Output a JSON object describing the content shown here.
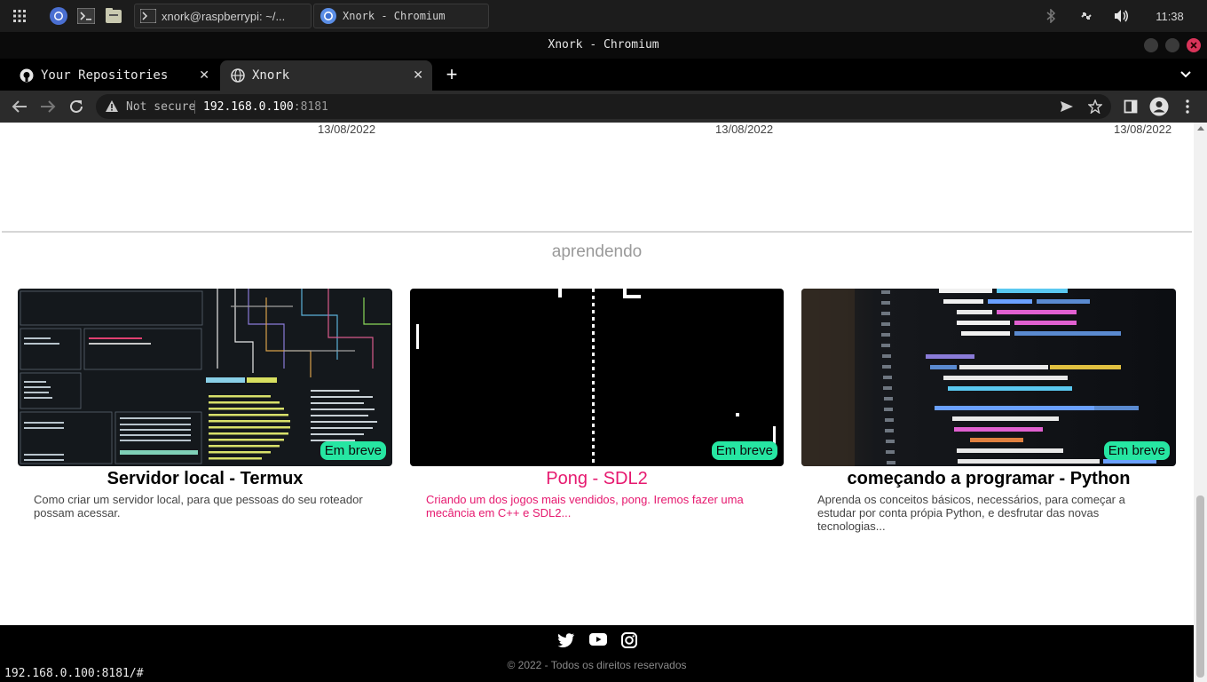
{
  "taskbar": {
    "tasks": [
      {
        "label": "xnork@raspberrypi: ~/..."
      },
      {
        "label": "Xnork - Chromium"
      }
    ],
    "clock": "11:38"
  },
  "window": {
    "title": "Xnork - Chromium"
  },
  "tabs": [
    {
      "label": "Your Repositories"
    },
    {
      "label": "Xnork"
    }
  ],
  "omnibox": {
    "security": "Not secure",
    "host": "192.168.0.100",
    "port": ":8181"
  },
  "page": {
    "dates": [
      "13/08/2022",
      "13/08/2022",
      "13/08/2022"
    ],
    "section_title": "aprendendo",
    "cards": [
      {
        "title": "Servidor local - Termux",
        "description": "Como criar um servidor local, para que pessoas do seu roteador possam acessar.",
        "badge": "Em breve"
      },
      {
        "title": "Pong - SDL2",
        "description": "Criando um dos jogos mais vendidos, pong. Iremos fazer uma mecância em C++ e SDL2...",
        "badge": "Em breve"
      },
      {
        "title": "começando a programar - Python",
        "description": "Aprenda os conceitos básicos, necessários, para começar a estudar por conta própia Python, e desfrutar das novas tecnologias...",
        "badge": "Em breve"
      }
    ],
    "footer": {
      "copyright": "© 2022 - Todos os direitos reservados"
    }
  },
  "status_url": "192.168.0.100:8181/#",
  "colors": {
    "badge": "#26e6a2",
    "highlight": "#e6196f",
    "footer": "#000000"
  },
  "icons": [
    "apps-icon",
    "chromium-icon",
    "terminal-icon",
    "files-icon",
    "bluetooth-icon",
    "network-icon",
    "volume-icon",
    "github-icon",
    "globe-icon",
    "twitter-icon",
    "youtube-icon",
    "instagram-icon"
  ]
}
